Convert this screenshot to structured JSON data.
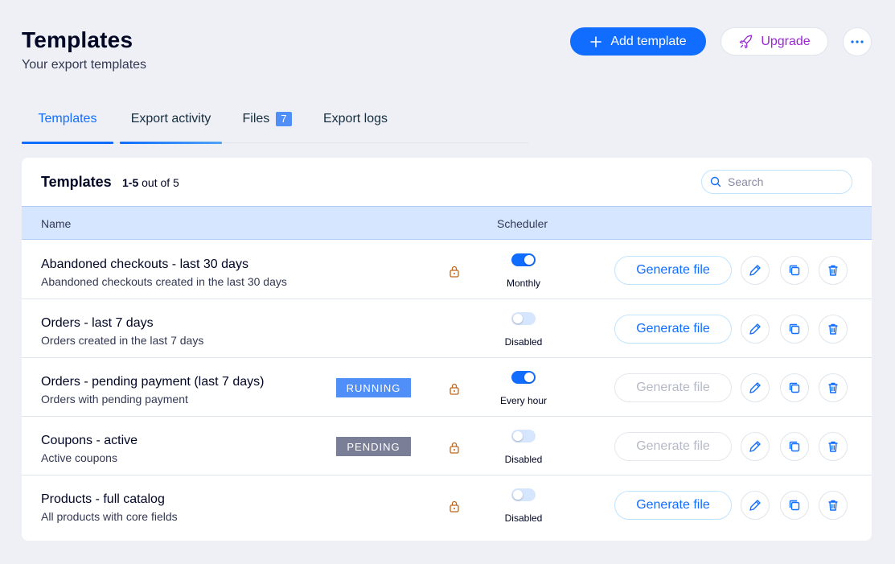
{
  "header": {
    "title": "Templates",
    "subtitle": "Your export templates",
    "add_label": "Add template",
    "upgrade_label": "Upgrade"
  },
  "tabs": [
    {
      "label": "Templates",
      "active": true
    },
    {
      "label": "Export activity",
      "active": false
    },
    {
      "label": "Files",
      "badge": "7",
      "active": false
    },
    {
      "label": "Export logs",
      "active": false
    }
  ],
  "card": {
    "title": "Templates",
    "range": "1-5",
    "count_suffix": "out of 5",
    "search_placeholder": "Search",
    "columns": {
      "name": "Name",
      "scheduler": "Scheduler"
    }
  },
  "generate_label": "Generate file",
  "rows": [
    {
      "name": "Abandoned checkouts - last 30 days",
      "description": "Abandoned checkouts created in the last 30 days",
      "status": "",
      "locked": true,
      "scheduler_on": true,
      "scheduler_label": "Monthly",
      "generate_enabled": true
    },
    {
      "name": "Orders - last 7 days",
      "description": "Orders created in the last 7 days",
      "status": "",
      "locked": false,
      "scheduler_on": false,
      "scheduler_label": "Disabled",
      "generate_enabled": true
    },
    {
      "name": "Orders - pending payment (last 7 days)",
      "description": "Orders with pending payment",
      "status": "RUNNING",
      "locked": true,
      "scheduler_on": true,
      "scheduler_label": "Every hour",
      "generate_enabled": false
    },
    {
      "name": "Coupons - active",
      "description": "Active coupons",
      "status": "PENDING",
      "locked": true,
      "scheduler_on": false,
      "scheduler_label": "Disabled",
      "generate_enabled": false
    },
    {
      "name": "Products - full catalog",
      "description": "All products with core fields",
      "status": "",
      "locked": true,
      "scheduler_on": false,
      "scheduler_label": "Disabled",
      "generate_enabled": true
    }
  ],
  "colors": {
    "accent": "#116dff",
    "upgrade": "#9a27d5",
    "lock": "#c0661b",
    "header_row": "#d6e6fe"
  }
}
